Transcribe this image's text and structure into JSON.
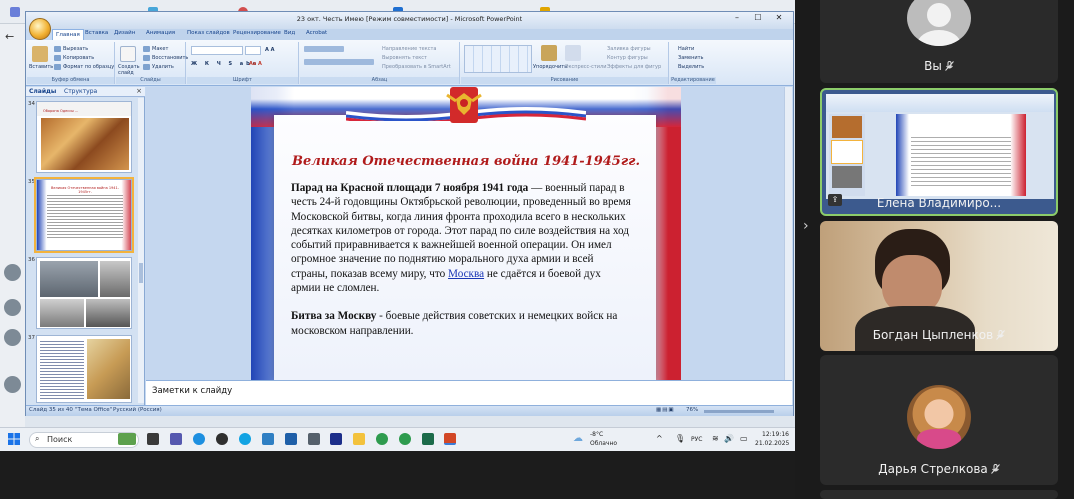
{
  "ppt": {
    "title": "23 окт. Честь Имею [Режим совместимости] - Microsoft PowerPoint",
    "tabs": [
      "Главная",
      "Вставка",
      "Дизайн",
      "Анимация",
      "Показ слайдов",
      "Рецензирование",
      "Вид",
      "Acrobat"
    ],
    "clipboard": {
      "paste": "Вставить",
      "cut": "Вырезать",
      "copy": "Копировать",
      "format": "Формат по образцу",
      "label": "Буфер обмена"
    },
    "slides_group": {
      "new": "Создать слайд",
      "layout": "Макет",
      "reset": "Восстановить",
      "delete": "Удалить",
      "label": "Слайды"
    },
    "font_label": "Шрифт",
    "para": {
      "label": "Абзац",
      "dir": "Направление текста",
      "align": "Выровнять текст",
      "smartart": "Преобразовать в SmartArt"
    },
    "drawing": {
      "label": "Рисование",
      "arrange": "Упорядочить",
      "styles": "Экспресс-стили",
      "fill": "Заливка фигуры",
      "outline": "Контур фигуры",
      "effects": "Эффекты для фигур"
    },
    "editing": {
      "label": "Редактирование",
      "find": "Найти",
      "replace": "Заменить",
      "select": "Выделить"
    },
    "pane_tabs": [
      "Слайды",
      "Структура"
    ],
    "slide_numbers": [
      "34",
      "35",
      "36",
      "37"
    ],
    "thumb_titles": [
      "Оборона Одессы ...",
      "Великая Отечественная война 1941-1945гг."
    ],
    "slide": {
      "title": "Великая Отечественная война 1941-1945гг.",
      "p1_bold": "Парад на Красной площади 7 ноября 1941 года",
      "p1_rest": " — военный парад в честь 24-й годовщины Октябрьской революции, проведенный во время Московской битвы, когда линия фронта проходила всего в нескольких десятках километров от города. Этот парад по силе воздействия на ход событий приравнивается к важнейшей военной операции. Он имел огромное значение по поднятию морального духа армии и всей страны, показав всему миру, что ",
      "p1_link": "Москва",
      "p1_end": " не сдаётся и боевой дух армии не сломлен.",
      "p2_bold": "Битва за Москву",
      "p2_rest": " - боевые действия советских и немецких войск на московском направлении."
    },
    "notes_placeholder": "Заметки к слайду",
    "status": {
      "slide": "Слайд 35 из 40",
      "theme": "\"Тема Office\"",
      "lang": "Русский (Россия)",
      "zoom": "76%"
    }
  },
  "taskbar": {
    "search": "Поиск",
    "weather_temp": "-8°C",
    "weather_desc": "Облачно",
    "lang": "РУС",
    "time": "12:19:16",
    "date": "21.02.2025"
  },
  "participants": [
    {
      "name": "Вы",
      "muted": true
    },
    {
      "name": "Елена Владимиро...",
      "muted": false
    },
    {
      "name": "Богдан Цыпленков",
      "muted": true
    },
    {
      "name": "Дарья Стрелкова",
      "muted": true
    }
  ]
}
